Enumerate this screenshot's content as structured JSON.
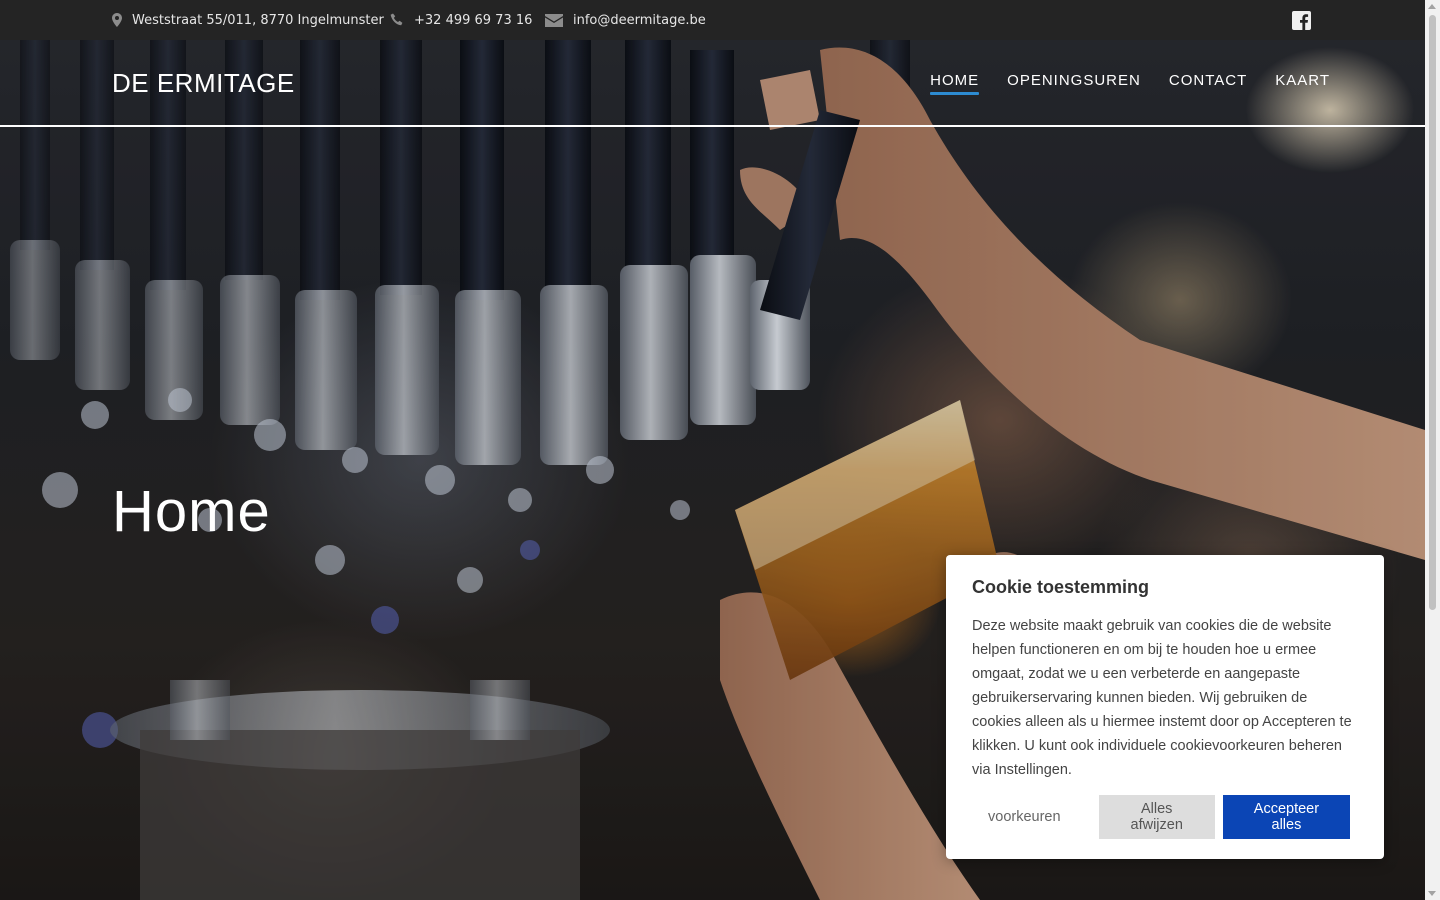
{
  "topbar": {
    "address": "Weststraat 55/011, 8770 Ingelmunster",
    "phone": "+32 499 69 73 16",
    "email": "info@deermitage.be"
  },
  "header": {
    "brand": "DE ERMITAGE",
    "nav": [
      {
        "label": "HOME",
        "active": true
      },
      {
        "label": "OPENINGSUREN",
        "active": false
      },
      {
        "label": "CONTACT",
        "active": false
      },
      {
        "label": "KAART",
        "active": false
      }
    ]
  },
  "hero": {
    "title": "Home"
  },
  "cookie": {
    "title": "Cookie toestemming",
    "body": "Deze website maakt gebruik van cookies die de website helpen functioneren en om bij te houden hoe u ermee omgaat, zodat we u een verbeterde en aangepaste gebruikerservaring kunnen bieden. Wij gebruiken de cookies alleen als u hiermee instemt door op Accepteren te klikken. U kunt ook individuele cookievoorkeuren beheren via Instellingen.",
    "preferences_label": "voorkeuren",
    "reject_label": "Alles afwijzen",
    "accept_label": "Accepteer alles"
  },
  "colors": {
    "accent": "#2d8bd1",
    "primary_button": "#0b45b5",
    "topbar": "#242424"
  },
  "icons": [
    "map-marker-icon",
    "phone-icon",
    "envelope-icon",
    "facebook-icon"
  ]
}
